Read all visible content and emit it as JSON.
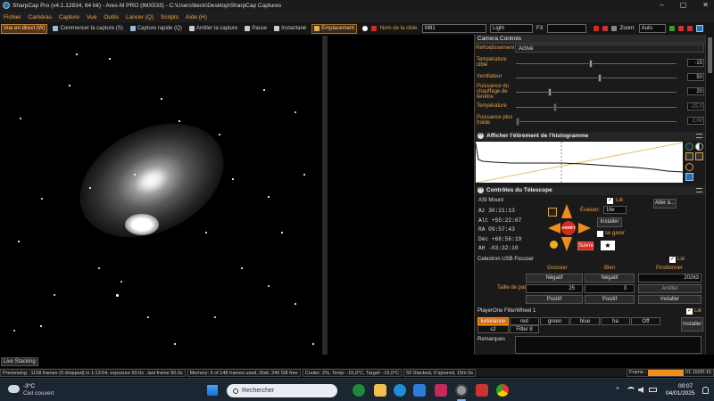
{
  "window": {
    "title": "SharpCap Pro (v4.1.12834, 64 bit) - Ares-M PRO (IMX533) - C:\\Users\\beck\\Desktop\\SharpCap Captures",
    "controls": [
      "–",
      "▢",
      "✕"
    ]
  },
  "menu": [
    "Fichier",
    "Caméras",
    "Capture",
    "Vue",
    "Outils",
    "Lancer (Q)",
    "Scripts",
    "Aide (H)"
  ],
  "toolbar": {
    "live_view": "Vue en direct (W)",
    "start_capture": "Commencer la capture (S)",
    "quick_capture": "Capture rapide (Q)",
    "stop_capture": "Arrêter la capture",
    "pause": "Pause",
    "snapshot": "Instantané",
    "placement": "Emplacement",
    "target_label": "Nom de la cible:",
    "target_value": "M81",
    "light_frame": "Light",
    "fx": "FX",
    "zoom_label": "Zoom:",
    "zoom_value": "Auto"
  },
  "camera_controls": {
    "header": "Camera Controls",
    "cooling_label": "Refroidissement",
    "cooling_value": "Activé",
    "rows": [
      {
        "label": "Température cible",
        "value": "-15"
      },
      {
        "label": "Ventilateur",
        "value": "50"
      },
      {
        "label": "Puissance du chauffage de fenêtre",
        "value": "20"
      },
      {
        "label": "Température",
        "value": "-15,0"
      },
      {
        "label": "Puissance plus froide",
        "value": "2,00"
      }
    ]
  },
  "histogram": {
    "title": "Afficher l'étirement de l'histogramme"
  },
  "telescope": {
    "title": "Contrôles du Télescope",
    "mount": "ASI Mount",
    "linked_label": "Lié",
    "goto_button": "Aller à...",
    "az": "Az   30:21:13",
    "alt": "Alt  +55:22:07",
    "ra": "RA   09:57:43",
    "dec": "Déc  +68:56:19",
    "ah": "AH   -03:32:10",
    "eval_label": "Évaluer:",
    "eval_value": "16x",
    "install_button": "Installer",
    "park_label": "se garer",
    "follow_button": "Suivre",
    "stop_label": "ARRÊT"
  },
  "focuser": {
    "title": "Celestron USB Focuser",
    "linked_label": "Lié",
    "col_coarse": "Grossier",
    "col_fine": "Bien",
    "col_position": "Positionner",
    "negative": "Négatif",
    "positive": "Positif",
    "step_label": "Taille de pas",
    "coarse_step": "25",
    "fine_step": "3",
    "position_value": "20263",
    "stop_button": "Arrêter",
    "install_button": "Installer"
  },
  "filterwheel": {
    "title": "PlayerOne FilterWheel 1",
    "linked_label": "Lié",
    "filters": [
      "luminance",
      "red",
      "green",
      "blue",
      "ha",
      "Off",
      "s2",
      "Filter 8"
    ],
    "install_button": "Installer",
    "remarks_label": "Remarques"
  },
  "live_stacking": "Live Stacking",
  "status": {
    "preview": "Previewing : 1158 frames (0 dropped) in 1:13:54, exposure 90.0s , last frame 90.0s",
    "memory": "Memory: 5 of 148 frames used, Disk: 246 GB free",
    "cooler": "Cooler: 2%, Temp: -15,0°C, Target: -15,0°C",
    "stacked": "50 Stacked, 0 Ignored, 15m 0s",
    "frame_label": "Frame :",
    "frame_time": "01:15/00:15",
    "frame_progress": 1.0
  },
  "taskbar": {
    "weather_temp": "-3°C",
    "weather_desc": "Ciel couvert",
    "search_placeholder": "Rechercher",
    "time": "00:07",
    "date": "04/01/2025"
  },
  "colors": {
    "accent": "#e5a04a",
    "stop_red": "#d62a1c",
    "arrow_orange": "#f08c1a"
  }
}
